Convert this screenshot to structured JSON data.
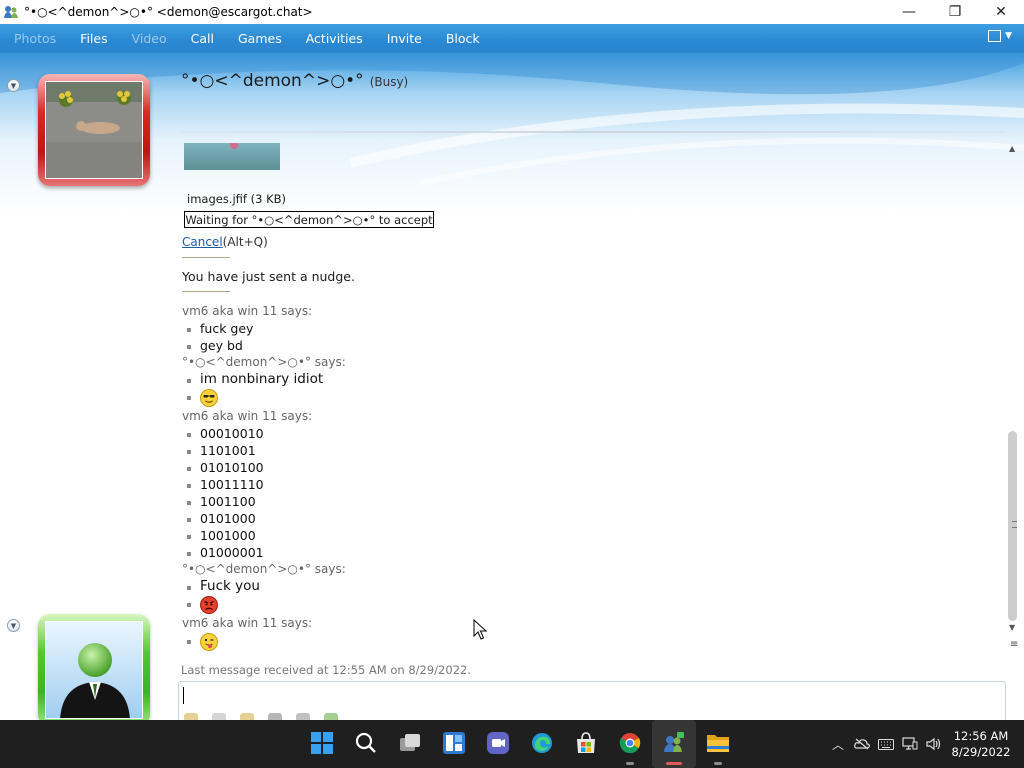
{
  "window": {
    "title": "°•○<^demon^>○•° <demon@escargot.chat>",
    "controls": {
      "minimize": "—",
      "maximize": "❐",
      "close": "✕"
    }
  },
  "menu": {
    "items": [
      {
        "label": "Photos",
        "enabled": false
      },
      {
        "label": "Files",
        "enabled": true
      },
      {
        "label": "Video",
        "enabled": false
      },
      {
        "label": "Call",
        "enabled": true
      },
      {
        "label": "Games",
        "enabled": true
      },
      {
        "label": "Activities",
        "enabled": true
      },
      {
        "label": "Invite",
        "enabled": true
      },
      {
        "label": "Block",
        "enabled": true
      }
    ]
  },
  "contact": {
    "name": "°•○<^demon^>○•°",
    "status": "(Busy)",
    "status_color": "#d42424"
  },
  "self": {
    "status_color": "#3fb224"
  },
  "transfer": {
    "file": "images.jfif (3 KB)",
    "status": "Waiting for °•○<^demon^>○•° to accept",
    "cancel_label": "Cancel",
    "cancel_shortcut": "(Alt+Q)"
  },
  "nudge_text": "You have just sent a nudge.",
  "messages": [
    {
      "sender": "vm6 aka win 11 says:",
      "lines": [
        {
          "text": "fuck gey"
        },
        {
          "text": "gey bd"
        }
      ]
    },
    {
      "sender": "°•○<^demon^>○•° says:",
      "lines": [
        {
          "text": "im nonbinary idiot",
          "big": true
        },
        {
          "emoji": "cool-face"
        }
      ]
    },
    {
      "sender": "vm6 aka win 11 says:",
      "lines": [
        {
          "text": "00010010"
        },
        {
          "text": "1101001"
        },
        {
          "text": "01010100"
        },
        {
          "text": "10011110"
        },
        {
          "text": "1001100"
        },
        {
          "text": "0101000"
        },
        {
          "text": "1001000"
        },
        {
          "text": "01000001"
        }
      ]
    },
    {
      "sender": "°•○<^demon^>○•° says:",
      "lines": [
        {
          "text": "Fuck you",
          "big": true
        },
        {
          "emoji": "angry-face"
        }
      ]
    },
    {
      "sender": "vm6 aka win 11 says:",
      "lines": [
        {
          "emoji": "tongue-face"
        }
      ]
    }
  ],
  "last_received": "Last message received at 12:55 AM on 8/29/2022.",
  "taskbar": {
    "apps": [
      "windows-start",
      "search",
      "task-view",
      "widgets",
      "teams-chat",
      "edge",
      "store",
      "chrome",
      "messenger",
      "file-explorer"
    ],
    "active": "messenger",
    "time": "12:56 AM",
    "date": "8/29/2022"
  }
}
